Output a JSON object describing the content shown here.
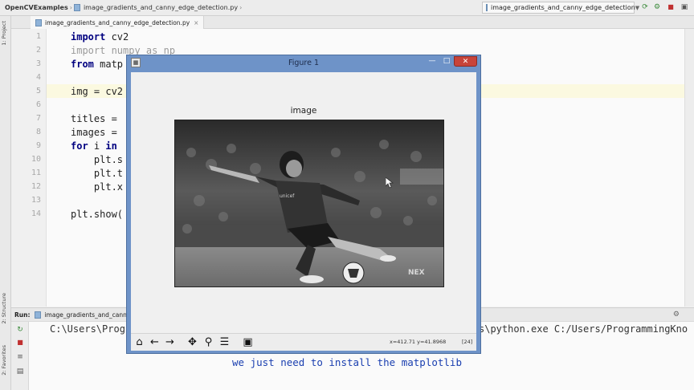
{
  "ide": {
    "project_name": "OpenCVExamples",
    "file_name": "image_gradients_and_canny_edge_detection.py",
    "run_config": "image_gradients_and_canny_edge_detection",
    "tab_label": "image_gradients_and_canny_edge_detection.py",
    "left_strip": {
      "project_label": "1: Project",
      "structure_label": "2: Structure",
      "favorites_label": "2: Favorites"
    }
  },
  "editor": {
    "line_numbers": [
      "1",
      "2",
      "3",
      "4",
      "5",
      "6",
      "7",
      "8",
      "9",
      "10",
      "11",
      "12",
      "13",
      "14"
    ],
    "lines": {
      "l1_kw": "import",
      "l1_rest": " cv2",
      "l2_text": "import numpy as np",
      "l3_kw": "from",
      "l3_rest": " matp",
      "l5_text": "img = cv2",
      "l7_text": "titles =",
      "l8_text": "images =",
      "l9_kw": "for",
      "l9_rest": " i ",
      "l9_kw2": "in",
      "l10_text": "    plt.s",
      "l11_text": "    plt.t",
      "l12_text": "    plt.x",
      "l14_text": "plt.show("
    }
  },
  "run_panel": {
    "label": "Run:",
    "tab_label": "image_gradients_and_cann",
    "console_left": "C:\\Users\\Prog",
    "console_right": "s\\python.exe C:/Users/ProgrammingKno"
  },
  "subtitle": "we just need to install the matplotlib",
  "figure": {
    "window_title": "Figure 1",
    "axes_title": "image",
    "watermark": "NEX",
    "status_coords": "x=412.71     y=41.8968",
    "status_value": "[24]",
    "toolbar_icons": [
      "home-icon",
      "back-arrow-icon",
      "forward-arrow-icon",
      "pan-icon",
      "zoom-icon",
      "subplots-config-icon",
      "save-icon"
    ]
  }
}
